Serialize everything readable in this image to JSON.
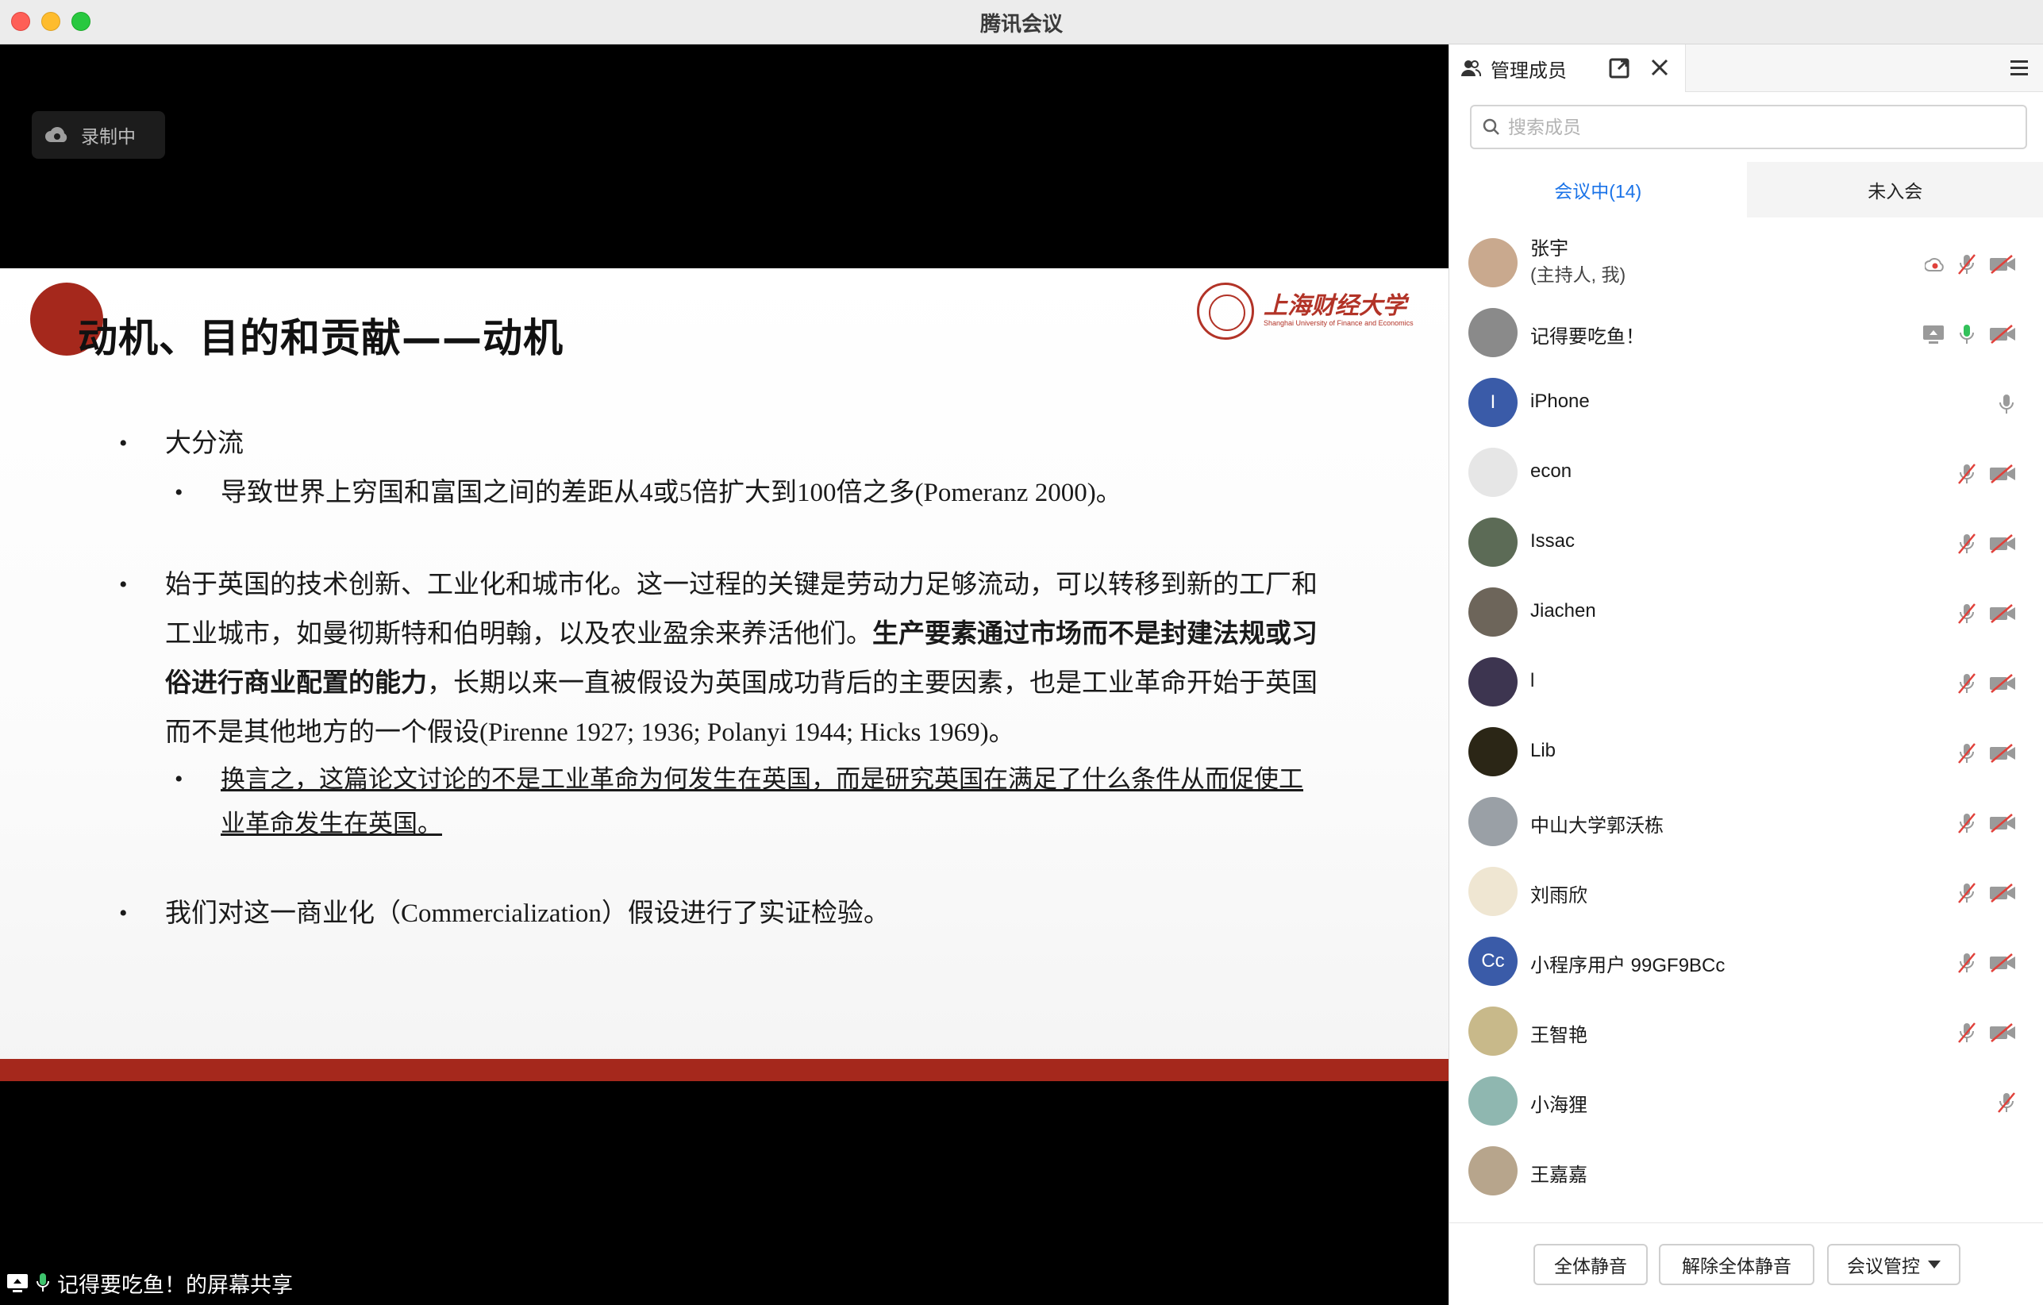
{
  "window": {
    "title": "腾讯会议"
  },
  "recording": {
    "label": "录制中",
    "icon": "cloud-record-icon"
  },
  "share": {
    "label": "记得要吃鱼！的屏幕共享",
    "icons": [
      "screen-share-icon",
      "mic-icon"
    ]
  },
  "slide": {
    "title": "动机、目的和贡献——动机",
    "university": {
      "name": "上海财经大学",
      "name_en": "Shanghai University of Finance and Economics"
    },
    "bullets": [
      {
        "text": "大分流"
      },
      {
        "text": "导致世界上穷国和富国之间的差距从4或5倍扩大到100倍之多(Pomeranz 2000)。"
      },
      {
        "text_a": "始于英国的技术创新、工业化和城市化。这一过程的关键是劳动力足够流动，可以转移到新的工厂和工业城市，如曼彻斯特和伯明翰，以及农业盈余来养活他们。",
        "text_bold": "生产要素通过市场而不是封建法规或习俗进行商业配置的能力",
        "text_b": "，长期以来一直被假设为英国成功背后的主要因素，也是工业革命开始于英国而不是其他地方的一个假设(Pirenne 1927; 1936; Polanyi 1944; Hicks 1969)。"
      },
      {
        "text": "换言之，这篇论文讨论的不是工业革命为何发生在英国，而是研究英国在满足了什么条件从而促使工业革命发生在英国。"
      },
      {
        "text": "我们对这一商业化（Commercialization）假设进行了实证检验。"
      }
    ],
    "accent_color": "#a5281c"
  },
  "panel": {
    "tab_label": "管理成员",
    "search_placeholder": "搜索成员",
    "tabs": [
      "会议中(14)",
      "未入会"
    ],
    "members": [
      {
        "name": "张宇",
        "sub": "(主持人, 我)",
        "avatar_text": "",
        "avatar_color": "#c9a98e",
        "icons": [
          "recording-icon",
          "mic-muted-icon",
          "camera-off-icon"
        ]
      },
      {
        "name": "记得要吃鱼！",
        "sub": "",
        "avatar_text": "",
        "avatar_color": "#8a8a8a",
        "icons": [
          "screen-share-icon",
          "mic-active-icon",
          "camera-off-icon"
        ]
      },
      {
        "name": "iPhone",
        "sub": "",
        "avatar_text": "I",
        "avatar_color": "#3a5ba8",
        "icons": [
          "mic-icon"
        ]
      },
      {
        "name": "econ",
        "sub": "",
        "avatar_text": "",
        "avatar_color": "#e6e6e6",
        "icons": [
          "mic-muted-icon",
          "camera-off-icon"
        ]
      },
      {
        "name": "Issac",
        "sub": "",
        "avatar_text": "",
        "avatar_color": "#5c6b56",
        "icons": [
          "mic-muted-icon",
          "camera-off-icon"
        ]
      },
      {
        "name": "Jiachen",
        "sub": "",
        "avatar_text": "",
        "avatar_color": "#6d655a",
        "icons": [
          "mic-muted-icon",
          "camera-off-icon"
        ]
      },
      {
        "name": "l",
        "sub": "",
        "avatar_text": "",
        "avatar_color": "#3d3550",
        "icons": [
          "mic-muted-icon",
          "camera-off-icon"
        ]
      },
      {
        "name": "Lib",
        "sub": "",
        "avatar_text": "",
        "avatar_color": "#2b2616",
        "icons": [
          "mic-muted-icon",
          "camera-off-icon"
        ]
      },
      {
        "name": "中山大学郭沃栋",
        "sub": "",
        "avatar_text": "",
        "avatar_color": "#9aa0a6",
        "icons": [
          "mic-muted-icon",
          "camera-off-icon"
        ]
      },
      {
        "name": "刘雨欣",
        "sub": "",
        "avatar_text": "",
        "avatar_color": "#efe6d2",
        "icons": [
          "mic-muted-icon",
          "camera-off-icon"
        ]
      },
      {
        "name": "小程序用户 99GF9BCc",
        "sub": "",
        "avatar_text": "Cc",
        "avatar_color": "#3a5ba8",
        "icons": [
          "mic-muted-icon",
          "camera-off-icon"
        ]
      },
      {
        "name": "王智艳",
        "sub": "",
        "avatar_text": "",
        "avatar_color": "#c8b98a",
        "icons": [
          "mic-muted-icon",
          "camera-off-icon"
        ]
      },
      {
        "name": "小海狸",
        "sub": "",
        "avatar_text": "",
        "avatar_color": "#8fb7b0",
        "icons": [
          "mic-muted-icon"
        ]
      },
      {
        "name": "王嘉嘉",
        "sub": "",
        "avatar_text": "",
        "avatar_color": "#b7a58c",
        "icons": []
      }
    ],
    "footer": {
      "mute_all": "全体静音",
      "unmute_all": "解除全体静音",
      "controls": "会议管控"
    }
  }
}
